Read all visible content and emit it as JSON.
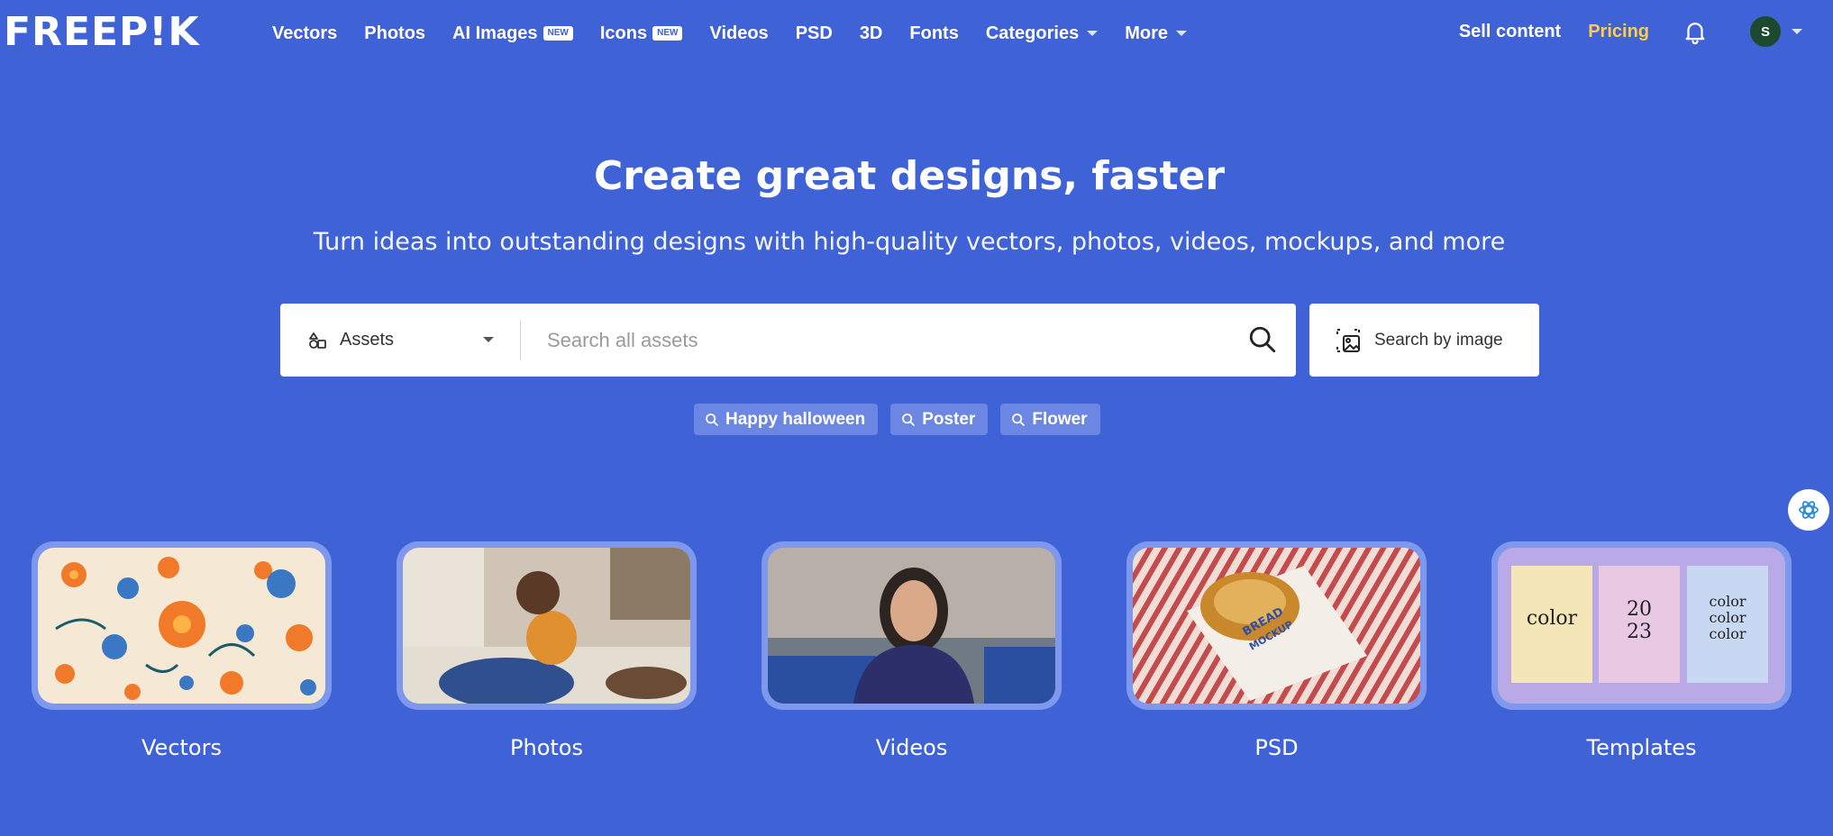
{
  "brand": {
    "logo_text": "FREEP!K"
  },
  "nav": {
    "links": [
      {
        "label": "Vectors"
      },
      {
        "label": "Photos"
      },
      {
        "label": "AI Images",
        "badge": "NEW"
      },
      {
        "label": "Icons",
        "badge": "NEW"
      },
      {
        "label": "Videos"
      },
      {
        "label": "PSD"
      },
      {
        "label": "3D"
      },
      {
        "label": "Fonts"
      },
      {
        "label": "Categories"
      },
      {
        "label": "More"
      }
    ],
    "sell_label": "Sell content",
    "pricing_label": "Pricing",
    "avatar_initial": "S"
  },
  "hero": {
    "title": "Create great designs, faster",
    "subtitle": "Turn ideas into outstanding designs with high-quality vectors, photos, videos, mockups, and more"
  },
  "search": {
    "asset_type": "Assets",
    "placeholder": "Search all assets",
    "value": "",
    "image_search_label": "Search by image"
  },
  "suggestions": [
    "Happy halloween",
    "Poster",
    "Flower"
  ],
  "categories": [
    {
      "label": "Vectors"
    },
    {
      "label": "Photos"
    },
    {
      "label": "Videos"
    },
    {
      "label": "PSD"
    },
    {
      "label": "Templates"
    }
  ],
  "template_card_texts": [
    "color",
    "20",
    "23",
    "color",
    "color",
    "color"
  ],
  "psd_card_text": [
    "BREAD",
    "MOCKUP"
  ],
  "colors": {
    "background": "#3f63d6",
    "pricing": "#ffcd4a",
    "chip": "#6c87e3",
    "card_frame": "#7e98ee"
  }
}
